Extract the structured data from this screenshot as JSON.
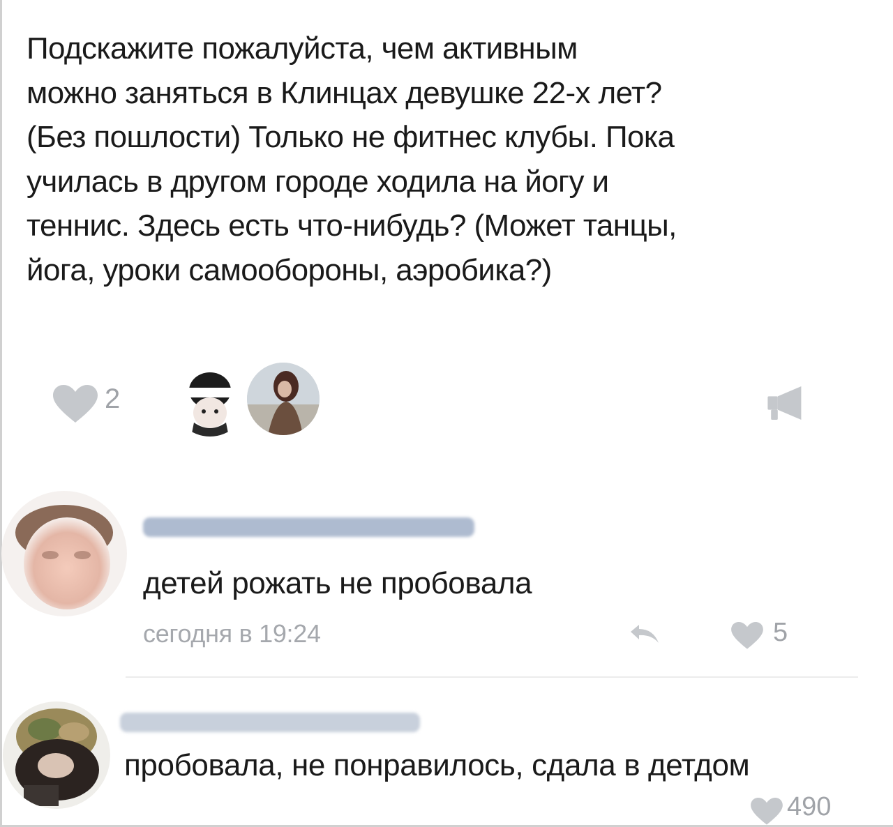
{
  "post": {
    "text_lines": [
      "Подскажите пожалуйста, чем активным",
      "можно заняться в Клинцах девушке 22-х лет?",
      "(Без пошлости) Только не фитнес клубы. Пока",
      "училась в другом городе ходила на йогу и",
      "теннис. Здесь есть что-нибудь? (Может танцы,",
      "йога, уроки самообороны, аэробика?)"
    ],
    "likes": "2",
    "like_icon": "heart-icon",
    "share_icon": "megaphone-icon"
  },
  "comments": [
    {
      "text": "детей рожать не пробовала",
      "time": "сегодня в 19:24",
      "likes": "5",
      "reply_icon": "reply-arrow-icon"
    },
    {
      "text": "пробовала, не понравилось, сдала в детдом",
      "likes": "490"
    }
  ],
  "colors": {
    "text": "#1a1a1a",
    "meta": "#a5a8ad",
    "icon": "#c5c8cc",
    "blurred_name": "#aebbd0"
  }
}
